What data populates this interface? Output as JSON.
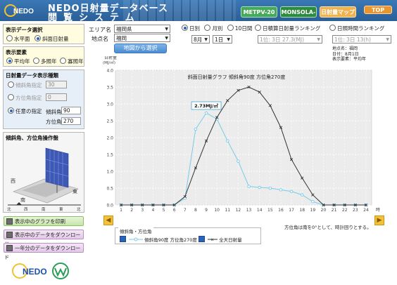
{
  "header": {
    "title_line1": "NEDO日射量データベース",
    "title_line2": "閲覧システム",
    "logo_text": "NEDO",
    "tabs": [
      "METPV-20",
      "MONSOLA-20",
      "日射量マップ",
      "TOP"
    ]
  },
  "left": {
    "display_data": {
      "title": "表示データ選択",
      "options": [
        "水平面",
        "斜面日射量"
      ],
      "selected": 1
    },
    "display_elem": {
      "title": "表示要素",
      "options": [
        "平均年",
        "多照年",
        "寡照年"
      ],
      "selected": 0
    },
    "slope_type": {
      "title": "日射量データ表示種類",
      "tilt_label": "傾斜角指定",
      "tilt_value": "30",
      "azimuth_label": "方位角指定",
      "azimuth_value": "0",
      "custom_label": "任意の指定",
      "custom_tilt_label": "傾斜角",
      "custom_tilt_value": "90",
      "custom_az_label": "方位角",
      "custom_az_value": "270"
    },
    "panel_ctrl": {
      "title": "傾斜角、方位角操作盤",
      "west": "西",
      "east": "東",
      "south": "南",
      "scale": [
        "北",
        "西",
        "南",
        "東",
        "北"
      ]
    },
    "buttons": [
      "表示中のグラフを印刷",
      "表示中のデータをダウンロード",
      "一年分のデータをダウンロード"
    ],
    "footer_logo_text": "NEDO"
  },
  "controls": {
    "area_label": "エリア名",
    "area_value": "福岡県",
    "point_label": "地点名",
    "point_value": "福岡",
    "map_button": "地図から選択",
    "period_options": [
      "日別",
      "月別",
      "10日間"
    ],
    "period_selected": 0,
    "month": "8月",
    "day": "1日",
    "rank1_label": "日積算日射量ランキング",
    "rank1_value": "1位: 3日  27.3(MJ)",
    "rank2_label": "日照時間ランキング",
    "rank2_value": "1位: 3日  13(h)",
    "info": [
      "地点名：福岡",
      "日付：8月1日",
      "表示要素：平均年"
    ]
  },
  "chart_data": {
    "type": "line",
    "title": "斜面日射量グラフ  傾斜角90度  方位角270度",
    "ylabel_line1": "日射量",
    "ylabel_line2": "(MJ/㎡)",
    "xlabel": "時",
    "x": [
      1,
      2,
      3,
      4,
      5,
      6,
      7,
      8,
      9,
      10,
      11,
      12,
      13,
      14,
      15,
      16,
      17,
      18,
      19,
      20,
      21,
      22,
      23,
      24
    ],
    "ylim": [
      0,
      4.0
    ],
    "yticks": [
      "0.0",
      "0.5",
      "1.0",
      "1.5",
      "2.0",
      "2.5",
      "3.0",
      "3.5",
      "4.0"
    ],
    "series": [
      {
        "name": "傾斜角90度 方位角270度",
        "color": "#77cbe8",
        "marker": "circle",
        "values": [
          0,
          0,
          0,
          0,
          0,
          0,
          0.2,
          2.25,
          2.73,
          2.55,
          1.9,
          1.3,
          0.55,
          0.52,
          0.5,
          0.45,
          0.4,
          0.3,
          0.1,
          0,
          0,
          0,
          0,
          0
        ]
      },
      {
        "name": "全天日射量",
        "color": "#333333",
        "marker": "x",
        "values": [
          0,
          0,
          0,
          0,
          0,
          0,
          0.25,
          1.1,
          1.9,
          2.6,
          3.1,
          3.4,
          3.5,
          3.35,
          2.95,
          2.3,
          1.35,
          0.8,
          0.3,
          0,
          0,
          0,
          0,
          0
        ]
      }
    ],
    "annotation": {
      "text": "2.73MJ/㎡"
    },
    "note": "方位角は南を0°として、時計回りとする。",
    "legend_title": "傾斜角・方位角",
    "grid": true
  }
}
